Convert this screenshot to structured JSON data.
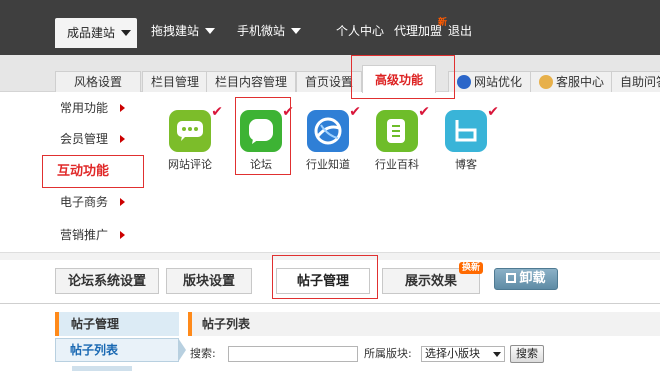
{
  "topnav": {
    "items": [
      {
        "label": "成品建站",
        "caret": true
      },
      {
        "label": "拖拽建站",
        "caret": true
      },
      {
        "label": "手机微站",
        "caret": true
      },
      {
        "label": "个人中心"
      },
      {
        "label": "代理加盟",
        "badge": "新"
      },
      {
        "label": "退出"
      }
    ]
  },
  "tabs": [
    {
      "label": "风格设置"
    },
    {
      "label": "栏目管理"
    },
    {
      "label": "栏目内容管理"
    },
    {
      "label": "首页设置"
    },
    {
      "label": "高级功能"
    },
    {
      "label": "网站优化",
      "icon": "paw-icon"
    },
    {
      "label": "客服中心",
      "icon": "person-icon"
    },
    {
      "label": "自助问答"
    }
  ],
  "sidemenu": {
    "items": [
      "常用功能",
      "会员管理",
      "互动功能",
      "电子商务",
      "营销推广"
    ]
  },
  "apps": [
    {
      "label": "网站评论",
      "color": "#7cbd2a",
      "icon": "comment-icon"
    },
    {
      "label": "论坛",
      "color": "#3db334",
      "icon": "forum-icon"
    },
    {
      "label": "行业知道",
      "color": "#2f7fd6",
      "icon": "globe-icon"
    },
    {
      "label": "行业百科",
      "color": "#6ebd2a",
      "icon": "book-icon"
    },
    {
      "label": "博客",
      "color": "#39b4d8",
      "icon": "blog-icon"
    }
  ],
  "subtabs": [
    {
      "label": "论坛系统设置"
    },
    {
      "label": "版块设置"
    },
    {
      "label": "帖子管理"
    },
    {
      "label": "展示效果",
      "badge": "换新"
    }
  ],
  "uninstall_label": "卸载",
  "leftnav": {
    "header": "帖子管理",
    "active": "帖子列表"
  },
  "panel": {
    "title": "帖子列表",
    "search_label": "搜索:",
    "search_value": "",
    "section_label": "所属版块:",
    "section_select": "选择小版块",
    "search_button": "搜索"
  }
}
